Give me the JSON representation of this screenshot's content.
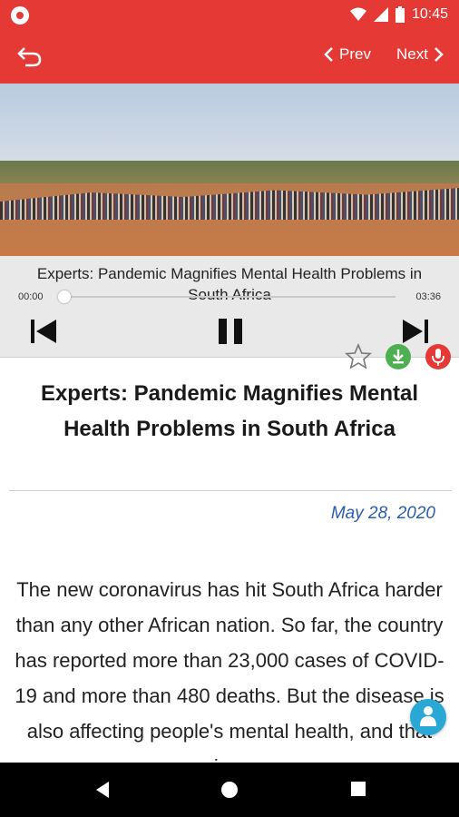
{
  "status_bar": {
    "time": "10:45"
  },
  "toolbar": {
    "prev_label": "Prev",
    "next_label": "Next"
  },
  "player": {
    "track_title": "Experts: Pandemic Magnifies Mental Health Problems in South Africa",
    "elapsed": "00:00",
    "duration": "03:36",
    "progress": 0.0
  },
  "article": {
    "headline": "Experts: Pandemic Magnifies Mental Health Problems in South Africa",
    "date": "May 28, 2020",
    "body": "The new coronavirus has hit South Africa harder than any other African nation. So far, the country has reported more than 23,000 cases of COVID-19 and more than 480 deaths. But the disease is also affecting people's mental health, and that is..."
  },
  "colors": {
    "accent": "#e53935",
    "date": "#2a5db0",
    "fab": "#29a8d6",
    "download": "#4caf50",
    "record": "#e53935"
  },
  "icons": [
    "back-arrow-icon",
    "chevron-left-icon",
    "chevron-right-icon",
    "skip-previous-icon",
    "pause-icon",
    "skip-next-icon",
    "star-icon",
    "download-icon",
    "microphone-icon",
    "translate-fab-icon"
  ]
}
